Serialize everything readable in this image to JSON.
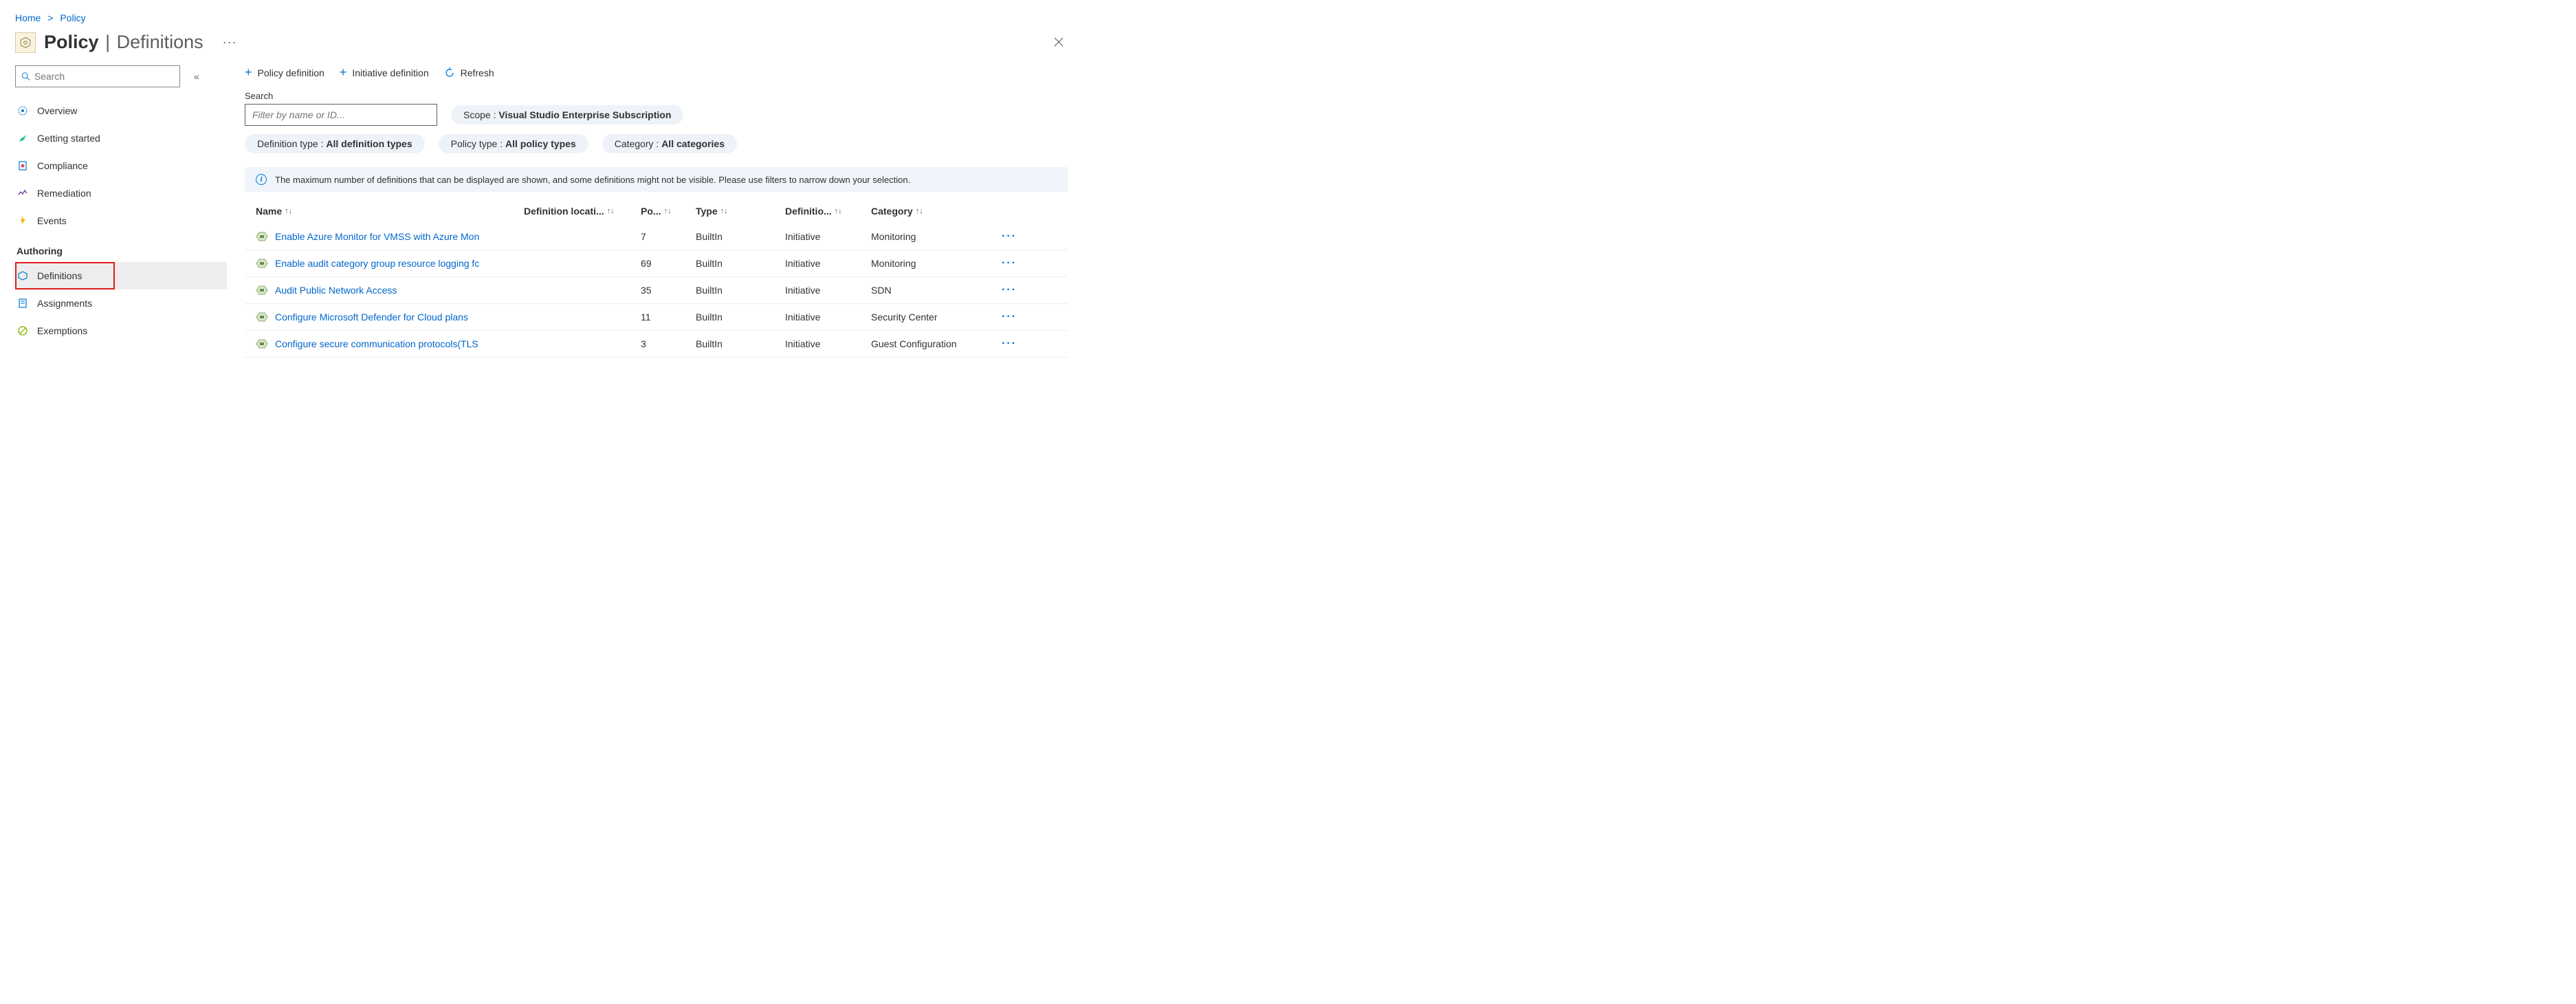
{
  "breadcrumb": {
    "home": "Home",
    "policy": "Policy"
  },
  "header": {
    "title_bold": "Policy",
    "title_thin": "Definitions",
    "more": "···"
  },
  "sidebar": {
    "search_placeholder": "Search",
    "items": {
      "overview": "Overview",
      "getting_started": "Getting started",
      "compliance": "Compliance",
      "remediation": "Remediation",
      "events": "Events"
    },
    "section_authoring": "Authoring",
    "authoring": {
      "definitions": "Definitions",
      "assignments": "Assignments",
      "exemptions": "Exemptions"
    }
  },
  "toolbar": {
    "policy_def": "Policy definition",
    "initiative_def": "Initiative definition",
    "refresh": "Refresh"
  },
  "search_section": {
    "label": "Search",
    "placeholder": "Filter by name or ID..."
  },
  "pills": {
    "scope_label": "Scope : ",
    "scope_value": "Visual Studio Enterprise Subscription",
    "deftype_label": "Definition type : ",
    "deftype_value": "All definition types",
    "poltype_label": "Policy type : ",
    "poltype_value": "All policy types",
    "cat_label": "Category : ",
    "cat_value": "All categories"
  },
  "info_banner": "The maximum number of definitions that can be displayed are shown, and some definitions might not be visible. Please use filters to narrow down your selection.",
  "table": {
    "headers": {
      "name": "Name",
      "defloc": "Definition locati...",
      "po": "Po...",
      "type": "Type",
      "definitio": "Definitio...",
      "category": "Category"
    },
    "rows": [
      {
        "name": "Enable Azure Monitor for VMSS with Azure Mon",
        "po": "7",
        "type": "BuiltIn",
        "def": "Initiative",
        "cat": "Monitoring"
      },
      {
        "name": "Enable audit category group resource logging fc",
        "po": "69",
        "type": "BuiltIn",
        "def": "Initiative",
        "cat": "Monitoring"
      },
      {
        "name": "Audit Public Network Access",
        "po": "35",
        "type": "BuiltIn",
        "def": "Initiative",
        "cat": "SDN"
      },
      {
        "name": "Configure Microsoft Defender for Cloud plans",
        "po": "11",
        "type": "BuiltIn",
        "def": "Initiative",
        "cat": "Security Center"
      },
      {
        "name": "Configure secure communication protocols(TLS",
        "po": "3",
        "type": "BuiltIn",
        "def": "Initiative",
        "cat": "Guest Configuration"
      }
    ]
  }
}
